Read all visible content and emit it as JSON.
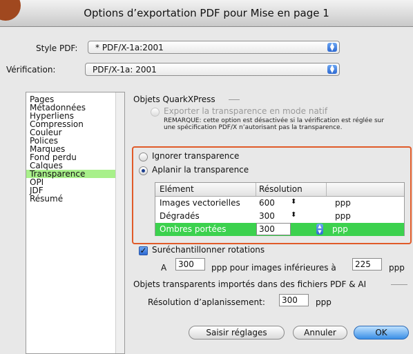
{
  "window": {
    "title": "Options d’exportation PDF pour Mise en page 1"
  },
  "top": {
    "style_label": "Style PDF:",
    "style_value": "* PDF/X-1a:2001",
    "verification_label": "Vérification:",
    "verification_value": "PDF/X-1a: 2001"
  },
  "categories": [
    {
      "label": "Pages"
    },
    {
      "label": "Métadonnées"
    },
    {
      "label": "Hyperliens"
    },
    {
      "label": "Compression"
    },
    {
      "label": "Couleur"
    },
    {
      "label": "Polices"
    },
    {
      "label": "Marques"
    },
    {
      "label": "Fond perdu"
    },
    {
      "label": "Calques"
    },
    {
      "label": "Transparence",
      "selected": true
    },
    {
      "label": "OPI"
    },
    {
      "label": "JDF"
    },
    {
      "label": "Résumé"
    }
  ],
  "quark": {
    "section_title": "Objets QuarkXPress",
    "export_native": "Exporter la transparence en mode natif",
    "note": "REMARQUE: cette option est désactivée si la vérification est réglée sur une spécification PDF/X n’autorisant pas la transparence.",
    "ignore": "Ignorer transparence",
    "flatten": "Aplanir la transparence",
    "table": {
      "col_element": "Elément",
      "col_resolution": "Résolution",
      "rows": [
        {
          "element": "Images vectorielles",
          "resolution": "600",
          "unit": "ppp"
        },
        {
          "element": "Dégradés",
          "resolution": "300",
          "unit": "ppp"
        },
        {
          "element": "Ombres portées",
          "resolution": "300",
          "unit": "ppp",
          "selected": true
        }
      ]
    },
    "oversample": "Suréchantillonner rotations",
    "a_label": "A",
    "a_value": "300",
    "ppp_for_images": "ppp pour images inférieures à",
    "threshold_value": "225",
    "ppp_suffix": "ppp"
  },
  "imported": {
    "section_title": "Objets transparents importés dans des fichiers PDF & AI",
    "flatten_res_label": "Résolution d’aplanissement:",
    "flatten_res_value": "300",
    "unit": "ppp"
  },
  "buttons": {
    "save_settings": "Saisir réglages",
    "cancel": "Annuler",
    "ok": "OK"
  }
}
